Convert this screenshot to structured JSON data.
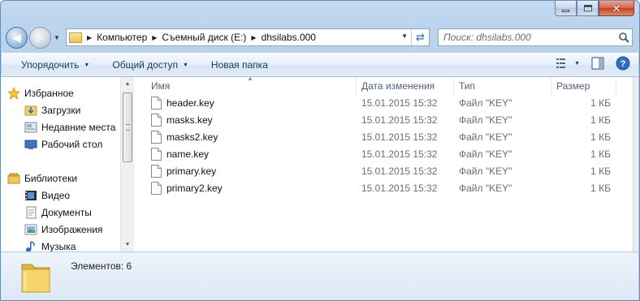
{
  "window": {
    "caption_buttons": [
      "minimize",
      "maximize",
      "close"
    ]
  },
  "address_bar": {
    "breadcrumbs": [
      "Компьютер",
      "Съемный диск (E:)",
      "dhsilabs.000"
    ]
  },
  "search": {
    "placeholder": "Поиск: dhsilabs.000"
  },
  "toolbar": {
    "organize": "Упорядочить",
    "share": "Общий доступ",
    "new_folder": "Новая папка",
    "icons": [
      "view-options-icon",
      "preview-pane-icon",
      "help-icon"
    ]
  },
  "nav_pane": {
    "favorites": {
      "label": "Избранное",
      "icon": "star-icon",
      "items": [
        {
          "label": "Загрузки",
          "icon": "downloads-folder-icon"
        },
        {
          "label": "Недавние места",
          "icon": "recent-places-icon"
        },
        {
          "label": "Рабочий стол",
          "icon": "desktop-icon"
        }
      ]
    },
    "libraries": {
      "label": "Библиотеки",
      "icon": "libraries-icon",
      "items": [
        {
          "label": "Видео",
          "icon": "video-icon"
        },
        {
          "label": "Документы",
          "icon": "documents-icon"
        },
        {
          "label": "Изображения",
          "icon": "pictures-icon"
        },
        {
          "label": "Музыка",
          "icon": "music-icon"
        }
      ]
    }
  },
  "file_list": {
    "columns": {
      "name": "Имя",
      "date": "Дата изменения",
      "type": "Тип",
      "size": "Размер"
    },
    "rows": [
      {
        "name": "header.key",
        "date": "15.01.2015 15:32",
        "type": "Файл \"KEY\"",
        "size": "1 КБ"
      },
      {
        "name": "masks.key",
        "date": "15.01.2015 15:32",
        "type": "Файл \"KEY\"",
        "size": "1 КБ"
      },
      {
        "name": "masks2.key",
        "date": "15.01.2015 15:32",
        "type": "Файл \"KEY\"",
        "size": "1 КБ"
      },
      {
        "name": "name.key",
        "date": "15.01.2015 15:32",
        "type": "Файл \"KEY\"",
        "size": "1 КБ"
      },
      {
        "name": "primary.key",
        "date": "15.01.2015 15:32",
        "type": "Файл \"KEY\"",
        "size": "1 КБ"
      },
      {
        "name": "primary2.key",
        "date": "15.01.2015 15:32",
        "type": "Файл \"KEY\"",
        "size": "1 КБ"
      }
    ]
  },
  "details_pane": {
    "count_text": "Элементов: 6"
  },
  "colors": {
    "frame": "#b9d1ea",
    "toolbar_text": "#1e395b",
    "column_header_text": "#4c607a",
    "secondary_text": "#6d6d6d"
  }
}
